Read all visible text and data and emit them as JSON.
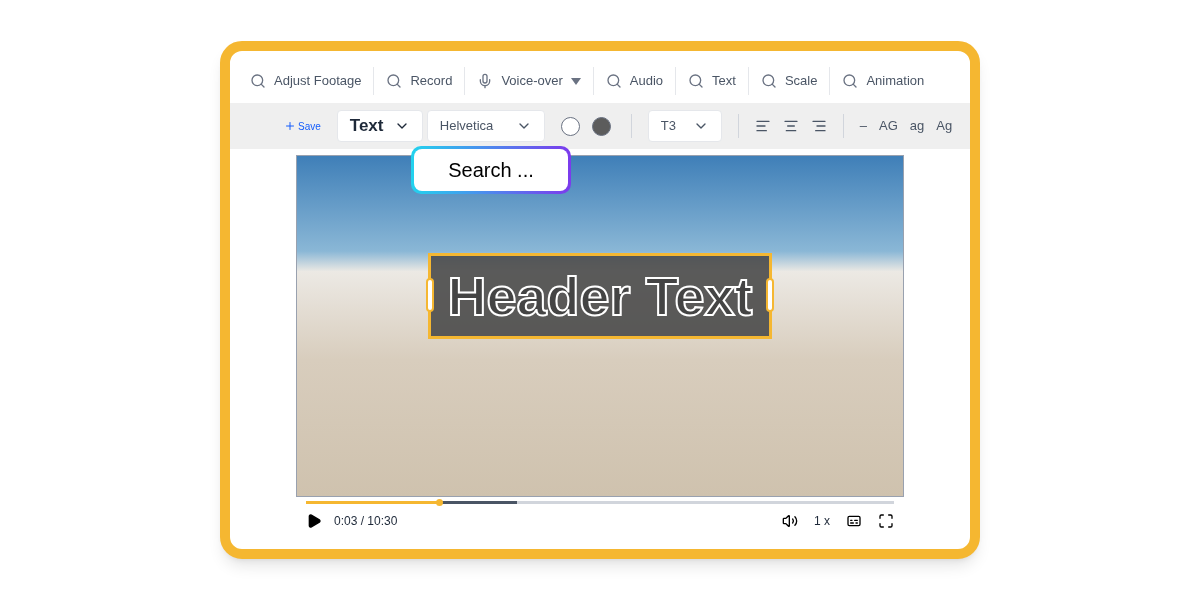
{
  "toolbar": [
    {
      "label": "Adjust Footage",
      "kind": "search"
    },
    {
      "label": "Record",
      "kind": "search"
    },
    {
      "label": "Voice-over",
      "kind": "mic",
      "dropdown": true
    },
    {
      "label": "Audio",
      "kind": "search"
    },
    {
      "label": "Text",
      "kind": "search"
    },
    {
      "label": "Scale",
      "kind": "search"
    },
    {
      "label": "Animation",
      "kind": "search"
    }
  ],
  "format_bar": {
    "save": "Save",
    "style_select": "Text",
    "font_select": "Helvetica",
    "colors": [
      {
        "color": "#ffffff"
      },
      {
        "color": "#5c5c5c"
      }
    ],
    "size_select": "T3",
    "align": [
      {
        "kind": "left"
      },
      {
        "kind": "center"
      },
      {
        "kind": "right"
      }
    ],
    "case_options": [
      "–",
      "AG",
      "ag",
      "Ag"
    ]
  },
  "search_popup": {
    "placeholder": "Search ..."
  },
  "video": {
    "overlay_text": "Header Text",
    "progress": {
      "level": 0.227
    },
    "buffer": {
      "level": 0.359
    },
    "time": "0:03 / 10:30",
    "speed": "1 x"
  }
}
